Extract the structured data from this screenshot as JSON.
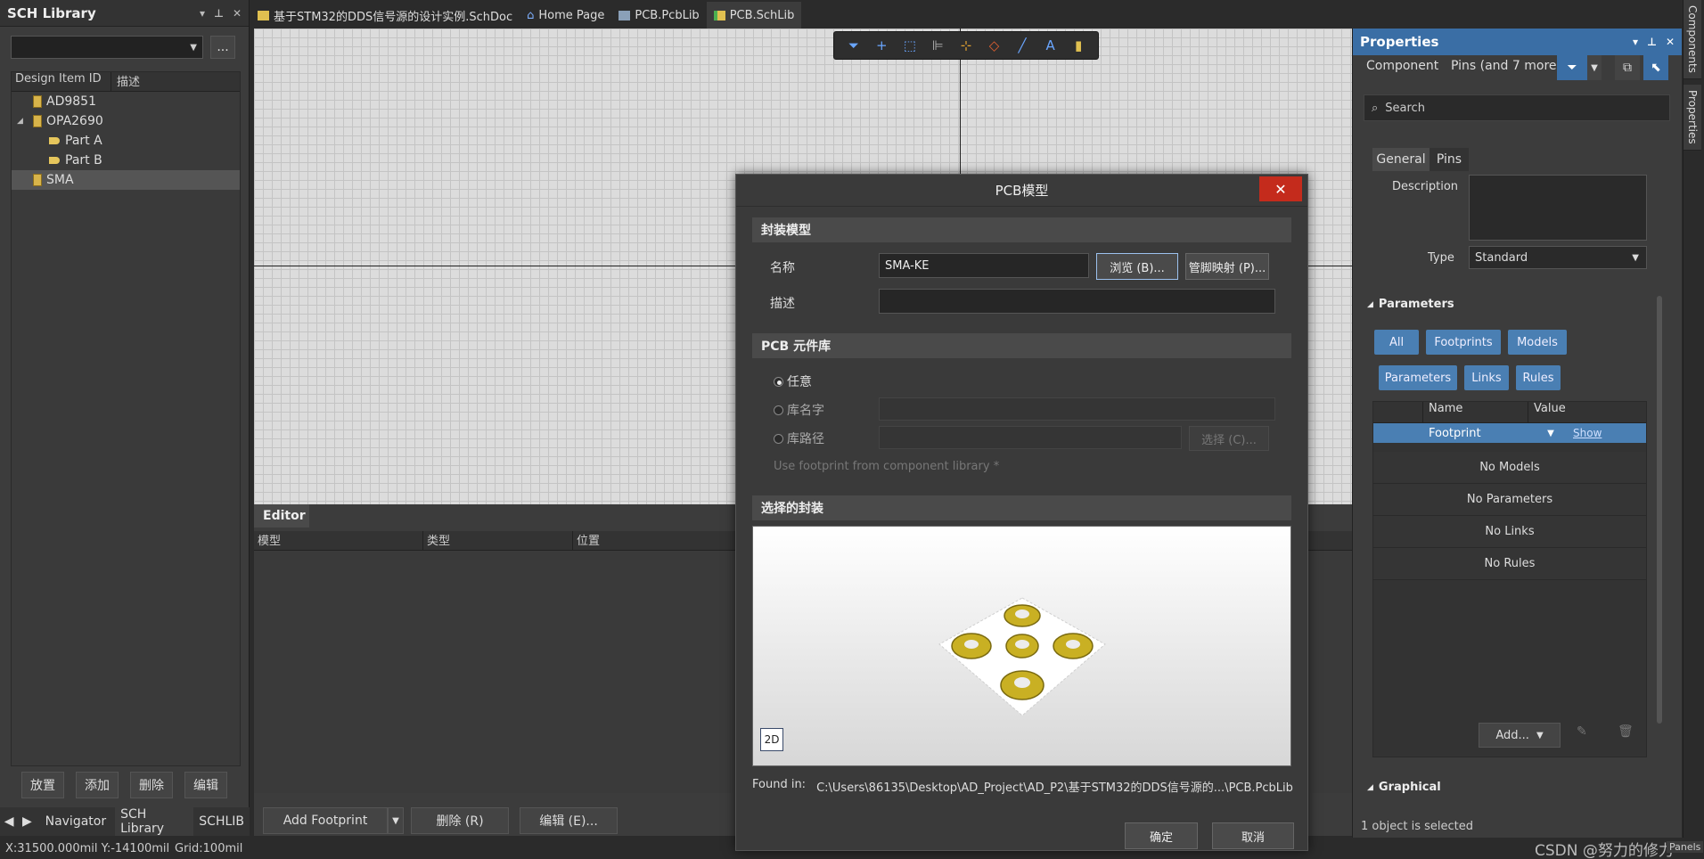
{
  "left_panel": {
    "title": "SCH Library",
    "browse_button": "...",
    "columns": [
      "Design Item ID",
      "描述"
    ],
    "items": [
      {
        "label": "AD9851"
      },
      {
        "label": "OPA2690"
      },
      {
        "label": "Part A"
      },
      {
        "label": "Part B"
      },
      {
        "label": "SMA"
      }
    ],
    "buttons": [
      "放置",
      "添加",
      "删除",
      "编辑"
    ],
    "bottom_tabs": [
      "Navigator",
      "SCH Library",
      "SCHLIB"
    ]
  },
  "tabs": [
    {
      "label": "基于STM32的DDS信号源的设计实例.SchDoc"
    },
    {
      "label": "Home Page"
    },
    {
      "label": "PCB.PcbLib"
    },
    {
      "label": "PCB.SchLib"
    }
  ],
  "editor": {
    "tab": "Editor",
    "columns": [
      "模型",
      "类型",
      "位置"
    ],
    "add_footprint": "Add Footprint",
    "delete": "删除 (R)",
    "edit": "编辑 (E)..."
  },
  "status": {
    "coords": "X:31500.000mil Y:-14100mil",
    "grid": "Grid:100mil",
    "watermark": "CSDN @努力的修力"
  },
  "properties": {
    "title": "Properties",
    "component": "Component",
    "pins_more": "Pins (and 7 more)",
    "search_placeholder": "Search",
    "tab_general": "General",
    "tab_pins": "Pins",
    "description_label": "Description",
    "type_label": "Type",
    "type_value": "Standard",
    "parameters_header": "Parameters",
    "chips": [
      "All",
      "Footprints",
      "Models",
      "Parameters",
      "Links",
      "Rules"
    ],
    "grid_name": "Name",
    "grid_value": "Value",
    "footprint_row": "Footprint",
    "footprint_show": "Show",
    "empty_rows": [
      "No Models",
      "No Parameters",
      "No Links",
      "No Rules"
    ],
    "add_button": "Add...",
    "graphical_header": "Graphical",
    "selected_status": "1 object is selected"
  },
  "side_tabs": [
    "Components",
    "Properties",
    "Panels"
  ],
  "dialog": {
    "title": "PCB模型",
    "close": "✕",
    "section_footprint": "封装模型",
    "name_label": "名称",
    "name_value": "SMA-KE",
    "browse": "浏览 (B)...",
    "pinmap": "管脚映射 (P)...",
    "desc_label": "描述",
    "section_library": "PCB 元件库",
    "radio_any": "任意",
    "radio_libname": "库名字",
    "radio_libpath": "库路径",
    "select": "选择 (C)...",
    "use_from_lib": "Use footprint from component library *",
    "section_selected": "选择的封装",
    "view_2d": "2D",
    "found_in_label": "Found in:",
    "found_in_path": "C:\\Users\\86135\\Desktop\\AD_Project\\AD_P2\\基于STM32的DDS信号源的...\\PCB.PcbLib",
    "ok": "确定",
    "cancel": "取消"
  }
}
